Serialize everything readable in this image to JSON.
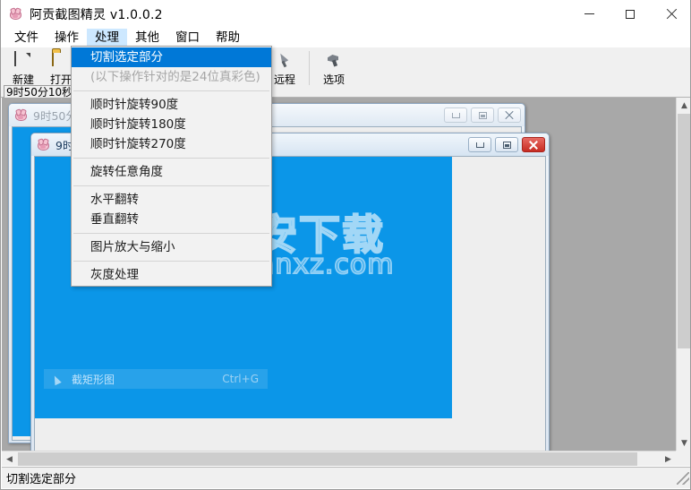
{
  "window": {
    "title": "阿贡截图精灵 v1.0.0.2",
    "icon": "pig-icon",
    "controls": {
      "minimize": "minimize-icon",
      "maximize": "maximize-icon",
      "close": "close-icon"
    }
  },
  "menubar": {
    "items": [
      {
        "label": "文件",
        "active": false
      },
      {
        "label": "操作",
        "active": false
      },
      {
        "label": "处理",
        "active": true
      },
      {
        "label": "其他",
        "active": false
      },
      {
        "label": "窗口",
        "active": false
      },
      {
        "label": "帮助",
        "active": false
      }
    ]
  },
  "toolbar": {
    "buttons": [
      {
        "label": "新建",
        "icon": "new-document-icon"
      },
      {
        "label": "打开",
        "icon": "open-folder-icon"
      },
      {
        "label": "远程",
        "icon": "remote-icon"
      },
      {
        "label": "选项",
        "icon": "options-icon"
      }
    ],
    "clock": "9时50分10秒"
  },
  "dropdown": {
    "owner": "处理",
    "items": [
      {
        "label": "切割选定部分",
        "state": "highlight"
      },
      {
        "label": "(以下操作针对的是24位真彩色)",
        "state": "disabled"
      },
      {
        "separator": true
      },
      {
        "label": "顺时针旋转90度",
        "state": "normal"
      },
      {
        "label": "顺时针旋转180度",
        "state": "normal"
      },
      {
        "label": "顺时针旋转270度",
        "state": "normal"
      },
      {
        "separator": true
      },
      {
        "label": "旋转任意角度",
        "state": "normal"
      },
      {
        "separator": true
      },
      {
        "label": "水平翻转",
        "state": "normal"
      },
      {
        "label": "垂直翻转",
        "state": "normal"
      },
      {
        "separator": true
      },
      {
        "label": "图片放大与缩小",
        "state": "normal"
      },
      {
        "separator": true
      },
      {
        "label": "灰度处理",
        "state": "normal"
      }
    ]
  },
  "mdi": {
    "child_windows": [
      {
        "title": "9时50分",
        "active": false,
        "buttons": {
          "minimize": "minimize-icon",
          "maximize": "maximize-icon",
          "close": "close-icon"
        }
      },
      {
        "title": "9时",
        "active": true,
        "buttons": {
          "minimize": "minimize-icon",
          "maximize": "maximize-icon",
          "close": "close-icon"
        },
        "context_row": {
          "icon": "snip-rect-icon",
          "label": "截矩形图",
          "shortcut": "Ctrl+G"
        }
      }
    ],
    "watermark": {
      "main": "安下载",
      "sub": "anxz.com",
      "badge": "安"
    }
  },
  "scrollbars": {
    "vertical": {
      "up": "chevron-up-icon",
      "down": "chevron-down-icon"
    },
    "horizontal": {
      "left": "chevron-left-icon",
      "right": "chevron-right-icon"
    }
  },
  "statusbar": {
    "text": "切割选定部分"
  },
  "colors": {
    "accent_blue": "#0b96e8",
    "menu_highlight": "#0078d7",
    "menu_active_bg": "#cde8ff",
    "mdi_background": "#a8a8a8",
    "toolbar_bg": "#f0f0f0",
    "close_red": "#c62b22"
  }
}
